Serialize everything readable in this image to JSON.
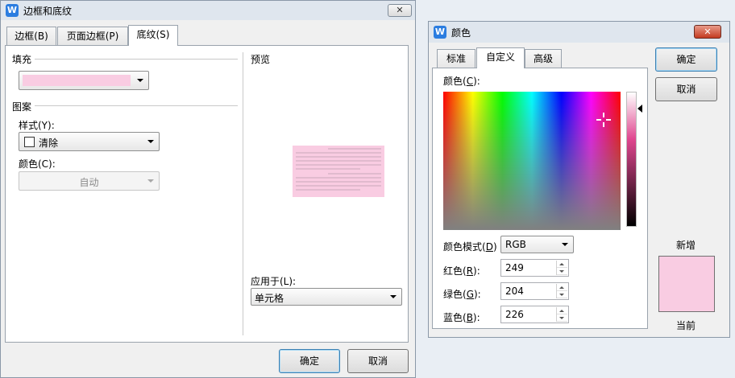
{
  "borders_dialog": {
    "title": "边框和底纹",
    "close_glyph": "✕",
    "tabs": [
      "边框(B)",
      "页面边框(P)",
      "底纹(S)"
    ],
    "fill_label": "填充",
    "fill_color": "#f9cce2",
    "pattern_label": "图案",
    "style_label": "样式(Y):",
    "style_value": "清除",
    "color_label": "颜色(C):",
    "color_value": "自动",
    "preview_label": "预览",
    "apply_label": "应用于(L):",
    "apply_value": "单元格",
    "ok": "确定",
    "cancel": "取消"
  },
  "color_dialog": {
    "title": "颜色",
    "close_glyph": "✕",
    "tabs": [
      "标准",
      "自定义",
      "高级"
    ],
    "colors_label_pre": "颜色(",
    "colors_label_key": "C",
    "colors_label_post": "):",
    "mode_label_pre": "颜色模式(",
    "mode_label_key": "D",
    "mode_label_post": ")",
    "mode_value": "RGB",
    "red_pre": "红色(",
    "red_key": "R",
    "red_post": "):",
    "red_value": "249",
    "green_pre": "绿色(",
    "green_key": "G",
    "green_post": "):",
    "green_value": "204",
    "blue_pre": "蓝色(",
    "blue_key": "B",
    "blue_post": "):",
    "blue_value": "226",
    "ok": "确定",
    "cancel": "取消",
    "new_label": "新增",
    "current_label": "当前",
    "swatch_color": "#f9cce2"
  }
}
